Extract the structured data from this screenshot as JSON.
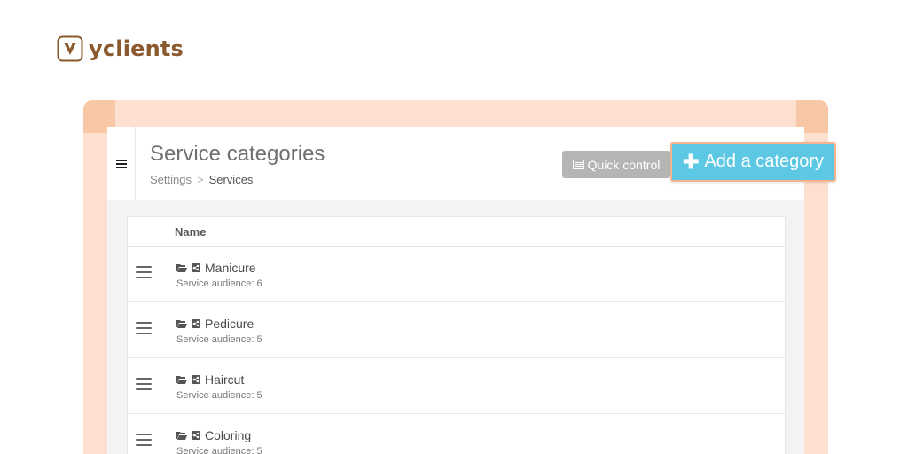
{
  "brand": {
    "name": "yclients",
    "color": "#8a5a2e"
  },
  "colors": {
    "frame": "#fde0cf",
    "frame_corner": "#f8c8a6",
    "accent": "#5cc8e4",
    "gray_button": "#b5b5b5"
  },
  "header": {
    "menu_icon": "hamburger-icon",
    "title": "Service categories",
    "breadcrumb": [
      "Settings",
      ">",
      "Services"
    ],
    "quick_control_label": "Quick control",
    "add_category_label": "Add a category"
  },
  "table": {
    "column_name": "Name",
    "rows": [
      {
        "name": "Manicure",
        "subtitle": "Service audience: 6"
      },
      {
        "name": "Pedicure",
        "subtitle": "Service audience: 5"
      },
      {
        "name": "Haircut",
        "subtitle": "Service audience: 5"
      },
      {
        "name": "Coloring",
        "subtitle": "Service audience: 5"
      }
    ]
  }
}
